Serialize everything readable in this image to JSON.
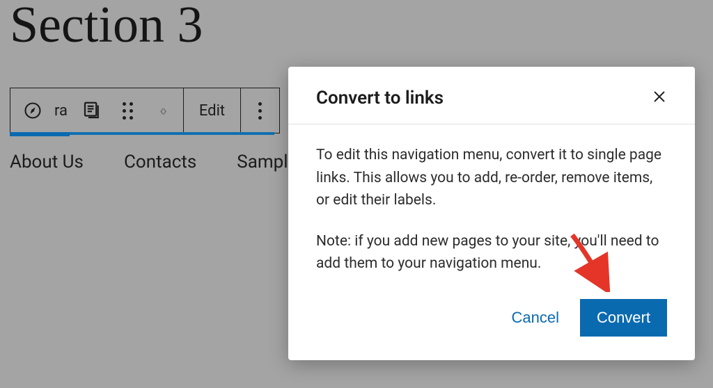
{
  "heading": "Section 3",
  "toolbar": {
    "fragment_text": "ra",
    "edit_label": "Edit"
  },
  "nav_items": [
    "About Us",
    "Contacts",
    "Sample P"
  ],
  "modal": {
    "title": "Convert to links",
    "body_p1": "To edit this navigation menu, convert it to single page links. This allows you to add, re-order, remove items, or edit their labels.",
    "body_p2": "Note: if you add new pages to your site, you'll need to add them to your navigation menu.",
    "cancel_label": "Cancel",
    "convert_label": "Convert"
  }
}
